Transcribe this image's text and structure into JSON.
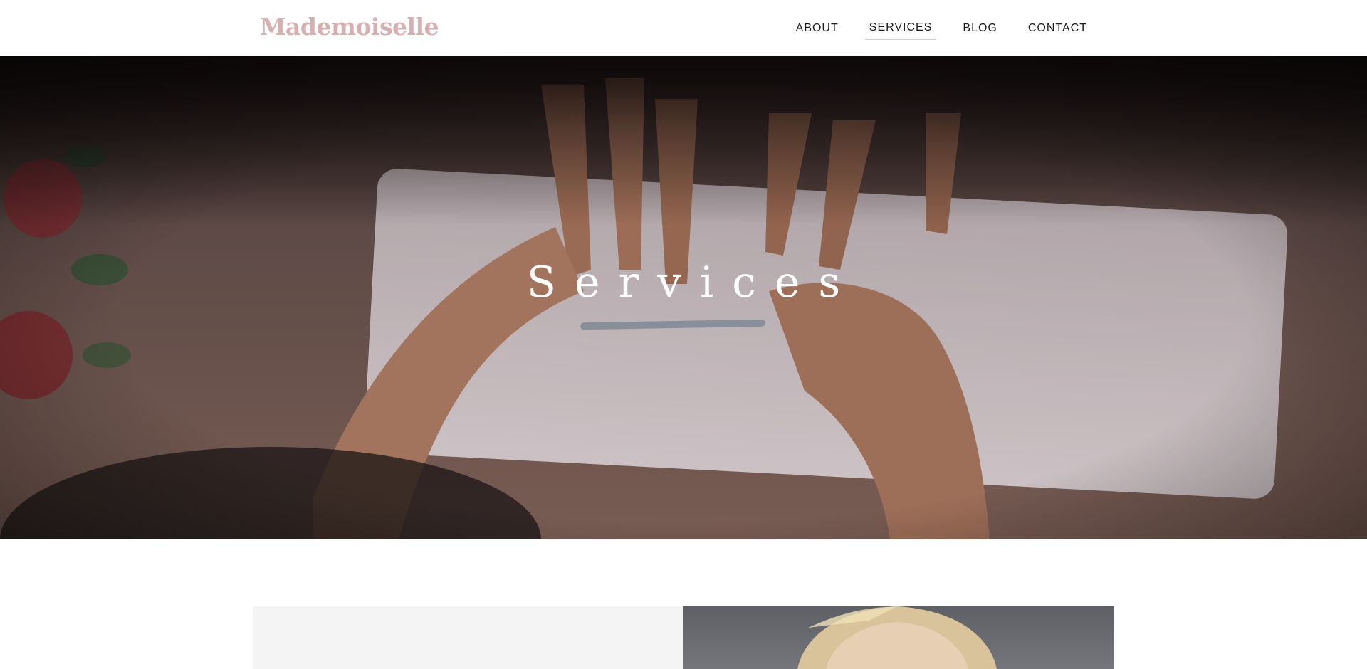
{
  "header": {
    "logo_text": "Mademoiselle",
    "nav": [
      {
        "label": "ABOUT",
        "active": false
      },
      {
        "label": "SERVICES",
        "active": true
      },
      {
        "label": "BLOG",
        "active": false
      },
      {
        "label": "CONTACT",
        "active": false
      }
    ]
  },
  "hero": {
    "title": "Services"
  },
  "colors": {
    "logo": "#d6b0b0",
    "nav_text": "#1a1a1a",
    "hero_text": "#ffffff",
    "panel_bg": "#f4f4f4"
  }
}
